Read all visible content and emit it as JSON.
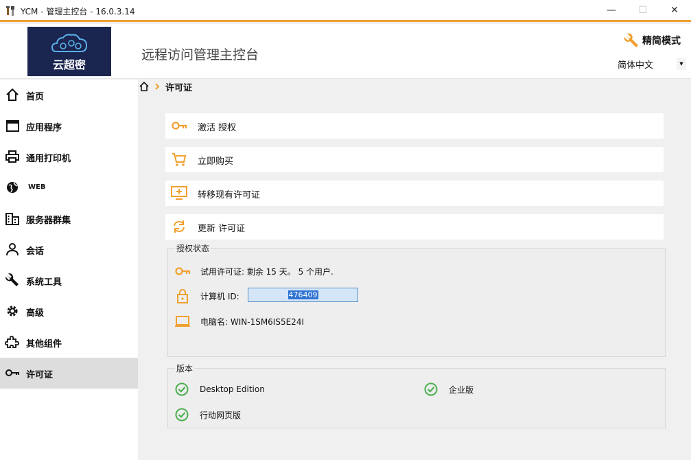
{
  "window": {
    "title": "YCM - 管理主控台 - 16.0.3.14",
    "minimize": "—",
    "maximize": "☐",
    "close": "✕"
  },
  "header": {
    "logo_text": "云超密",
    "console_title": "远程访问管理主控台",
    "mode_label": "精简模式",
    "language": "简体中文"
  },
  "sidebar": {
    "items": [
      {
        "label": "首页",
        "icon": "home-icon"
      },
      {
        "label": "应用程序",
        "icon": "window-icon"
      },
      {
        "label": "通用打印机",
        "icon": "printer-icon"
      },
      {
        "label": "WEB",
        "icon": "globe-icon"
      },
      {
        "label": "服务器群集",
        "icon": "building-icon"
      },
      {
        "label": "会话",
        "icon": "user-icon"
      },
      {
        "label": "系统工具",
        "icon": "wrench-icon"
      },
      {
        "label": "高级",
        "icon": "gear-icon"
      },
      {
        "label": "其他组件",
        "icon": "puzzle-icon"
      },
      {
        "label": "许可证",
        "icon": "key-icon",
        "active": true
      }
    ]
  },
  "breadcrumb": {
    "current": "许可证"
  },
  "actions": [
    {
      "label": "激活 授权",
      "icon": "key-icon"
    },
    {
      "label": "立即购买",
      "icon": "cart-icon"
    },
    {
      "label": "转移现有许可证",
      "icon": "monitor-plus-icon"
    },
    {
      "label": "更新 许可证",
      "icon": "refresh-icon"
    }
  ],
  "license_status": {
    "title": "授权状态",
    "trial": "试用许可证: 剩余 15 天。 5 个用户.",
    "machine_id_label": "计算机 ID:",
    "machine_id": "476409",
    "computer_name": "电脑名: WIN-1SM6IS5E24I"
  },
  "version": {
    "title": "版本",
    "editions": [
      "Desktop Edition",
      "企业版",
      "行动网页版"
    ]
  },
  "colors": {
    "accent": "#f0a030",
    "check": "#4caf50",
    "logo_bg": "#1a2550"
  }
}
